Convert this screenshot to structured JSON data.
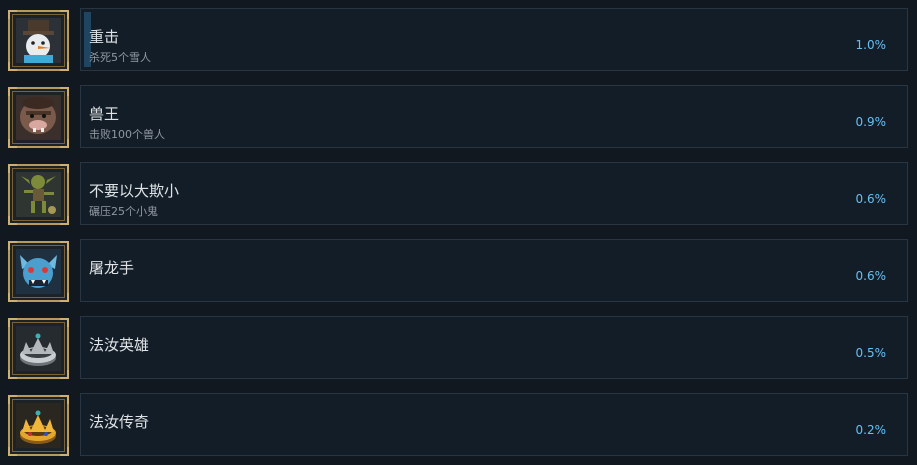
{
  "achievements": [
    {
      "title": "重击",
      "description": "杀死5个雪人",
      "percent_label": "1.0%",
      "percent": 1.0,
      "icon": "snowman-icon"
    },
    {
      "title": "兽王",
      "description": "击败100个兽人",
      "percent_label": "0.9%",
      "percent": 0.9,
      "icon": "orc-icon"
    },
    {
      "title": "不要以大欺小",
      "description": "碾压25个小鬼",
      "percent_label": "0.6%",
      "percent": 0.6,
      "icon": "goblin-icon"
    },
    {
      "title": "屠龙手",
      "description": "",
      "percent_label": "0.6%",
      "percent": 0.6,
      "icon": "dragon-icon"
    },
    {
      "title": "法汝英雄",
      "description": "",
      "percent_label": "0.5%",
      "percent": 0.5,
      "icon": "silver-crown-icon"
    },
    {
      "title": "法汝传奇",
      "description": "",
      "percent_label": "0.2%",
      "percent": 0.2,
      "icon": "gold-crown-icon"
    }
  ],
  "colors": {
    "accent": "#66c0f4",
    "frame": "#b89a5c",
    "card_border": "#283643",
    "progress": "#1f4561"
  }
}
